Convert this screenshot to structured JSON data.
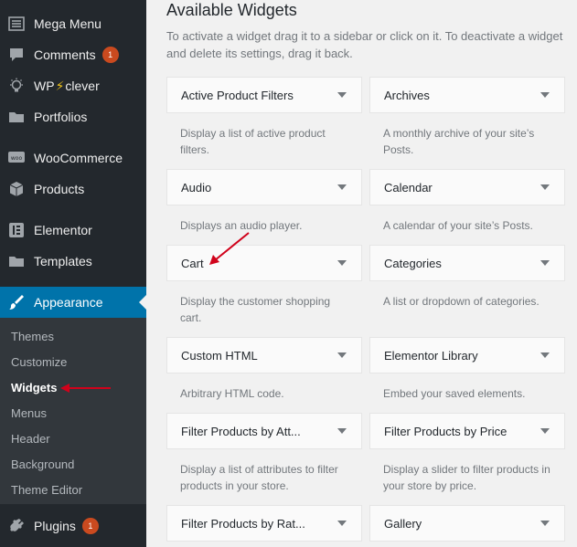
{
  "sidebar": {
    "items": [
      {
        "label": "Mega Menu",
        "icon": "list-icon"
      },
      {
        "label": "Comments",
        "icon": "comment-icon",
        "badge": "1"
      },
      {
        "label_prefix": "WP",
        "label_suffix": "clever",
        "icon": "bulb-icon"
      },
      {
        "label": "Portfolios",
        "icon": "folder-icon"
      },
      {
        "label": "WooCommerce",
        "icon": "woo-icon"
      },
      {
        "label": "Products",
        "icon": "box-icon"
      },
      {
        "label": "Elementor",
        "icon": "elementor-icon"
      },
      {
        "label": "Templates",
        "icon": "folder-icon"
      },
      {
        "label": "Appearance",
        "icon": "brush-icon"
      },
      {
        "label": "Plugins",
        "icon": "plug-icon",
        "badge": "1"
      }
    ],
    "submenu": [
      "Themes",
      "Customize",
      "Widgets",
      "Menus",
      "Header",
      "Background",
      "Theme Editor"
    ]
  },
  "main": {
    "title": "Available Widgets",
    "description": "To activate a widget drag it to a sidebar or click on it. To deactivate a widget and delete its settings, drag it back.",
    "widgets": [
      {
        "title": "Active Product Filters",
        "desc": "Display a list of active product filters."
      },
      {
        "title": "Archives",
        "desc": "A monthly archive of your site’s Posts."
      },
      {
        "title": "Audio",
        "desc": "Displays an audio player."
      },
      {
        "title": "Calendar",
        "desc": "A calendar of your site’s Posts."
      },
      {
        "title": "Cart",
        "desc": "Display the customer shopping cart."
      },
      {
        "title": "Categories",
        "desc": "A list or dropdown of categories."
      },
      {
        "title": "Custom HTML",
        "desc": "Arbitrary HTML code."
      },
      {
        "title": "Elementor Library",
        "desc": "Embed your saved elements."
      },
      {
        "title": "Filter Products by Att...",
        "desc": "Display a list of attributes to filter products in your store."
      },
      {
        "title": "Filter Products by Price",
        "desc": "Display a slider to filter products in your store by price."
      },
      {
        "title": "Filter Products by Rat...",
        "desc": ""
      },
      {
        "title": "Gallery",
        "desc": ""
      }
    ]
  },
  "colors": {
    "sidebar_bg": "#23282d",
    "submenu_bg": "#32373c",
    "accent": "#0073aa",
    "badge": "#ca4a1f",
    "annotation": "#d0021b"
  }
}
